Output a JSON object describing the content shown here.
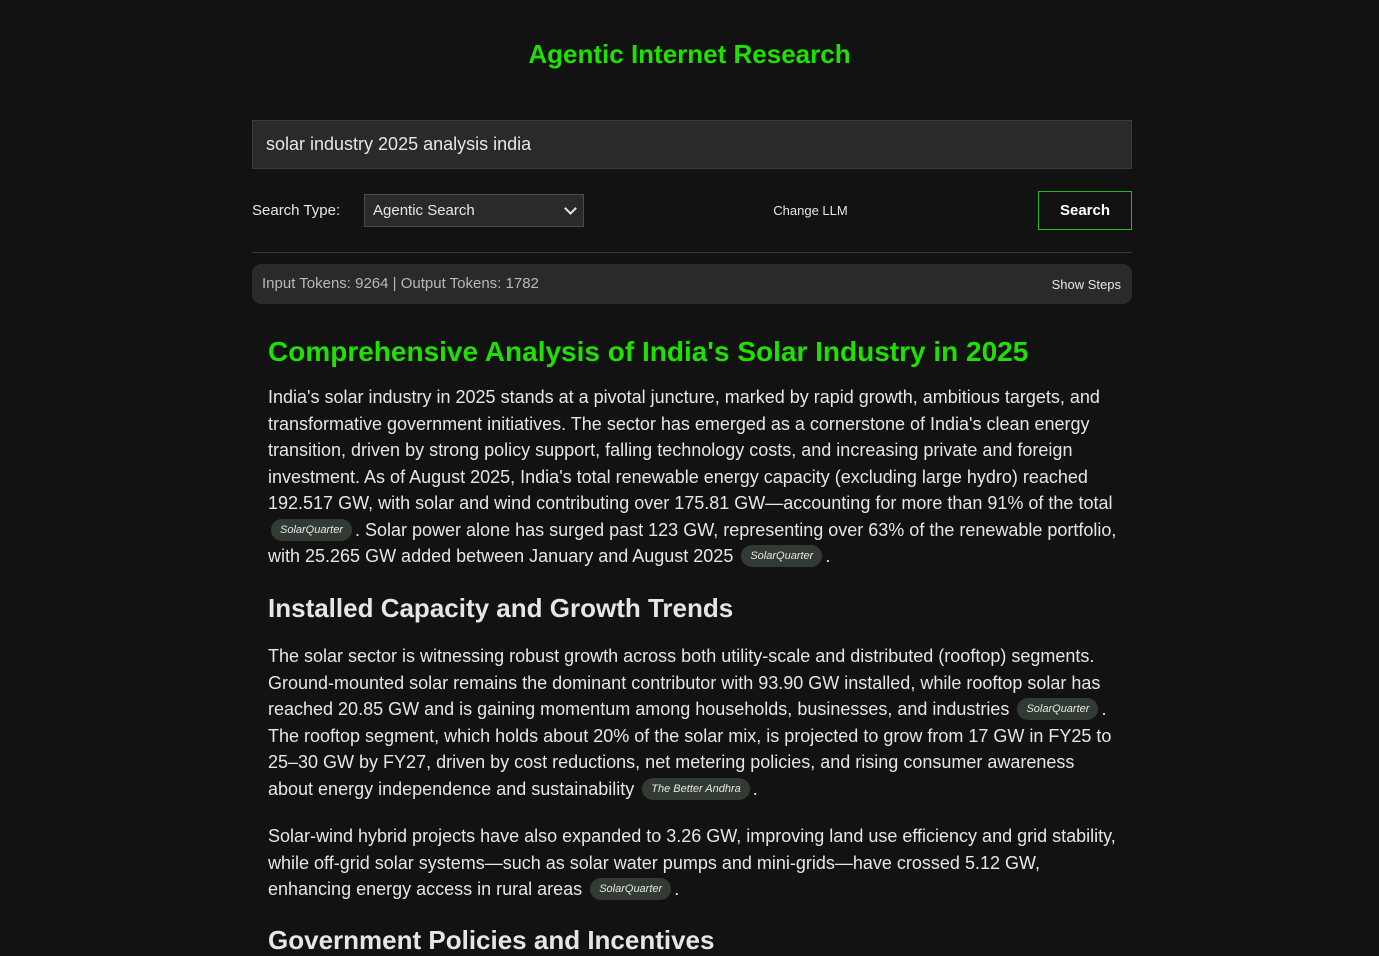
{
  "header": {
    "title": "Agentic Internet Research"
  },
  "search": {
    "query": "solar industry 2025 analysis india",
    "type_label": "Search Type:",
    "type_selected": "Agentic Search",
    "change_llm_label": "Change LLM",
    "search_button_label": "Search"
  },
  "tokens": {
    "summary": "Input Tokens: 9264 | Output Tokens: 1782",
    "show_steps_label": "Show Steps"
  },
  "report": {
    "title": "Comprehensive Analysis of India's Solar Industry in 2025",
    "intro": {
      "text1": "India's solar industry in 2025 stands at a pivotal juncture, marked by rapid growth, ambitious targets, and transformative government initiatives. The sector has emerged as a cornerstone of India's clean energy transition, driven by strong policy support, falling technology costs, and increasing private and foreign investment. As of August 2025, India's total renewable energy capacity (excluding large hydro) reached 192.517 GW, with solar and wind contributing over 175.81 GW—accounting for more than 91% of the total",
      "cite1": "SolarQuarter",
      "text2": ". Solar power alone has surged past 123 GW, representing over 63% of the renewable portfolio, with 25.265 GW added between January and August 2025",
      "cite2": "SolarQuarter",
      "text3": "."
    },
    "section1": {
      "heading": "Installed Capacity and Growth Trends",
      "p1": {
        "text1": "The solar sector is witnessing robust growth across both utility-scale and distributed (rooftop) segments. Ground-mounted solar remains the dominant contributor with 93.90 GW installed, while rooftop solar has reached 20.85 GW and is gaining momentum among households, businesses, and industries",
        "cite1": "SolarQuarter",
        "text2": ". The rooftop segment, which holds about 20% of the solar mix, is projected to grow from 17 GW in FY25 to 25–30 GW by FY27, driven by cost reductions, net metering policies, and rising consumer awareness about energy independence and sustainability",
        "cite2": "The Better Andhra",
        "text3": "."
      },
      "p2": {
        "text1": "Solar-wind hybrid projects have also expanded to 3.26 GW, improving land use efficiency and grid stability, while off-grid solar systems—such as solar water pumps and mini-grids—have crossed 5.12 GW, enhancing energy access in rural areas",
        "cite1": "SolarQuarter",
        "text2": "."
      }
    },
    "section2": {
      "heading": "Government Policies and Incentives"
    }
  }
}
